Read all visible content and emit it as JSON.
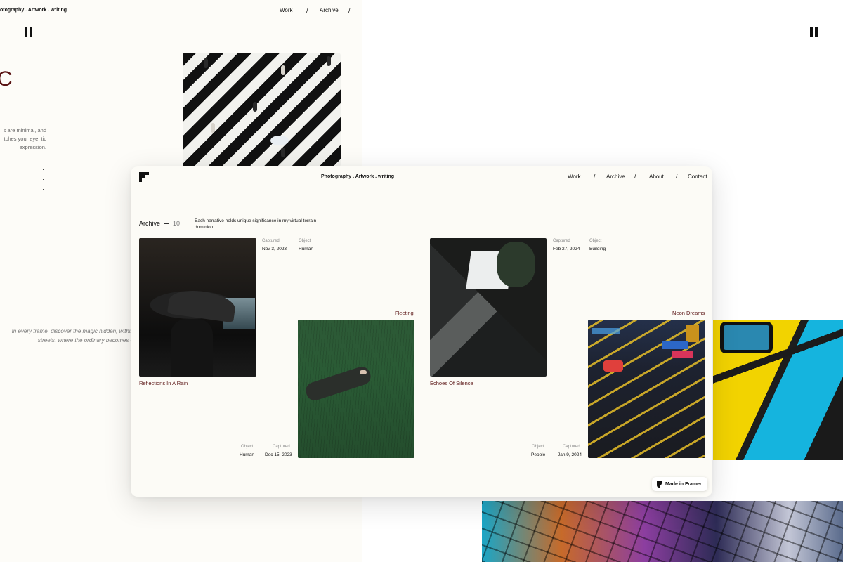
{
  "background_left": {
    "brand": "otography . Artwork . writing",
    "nav": [
      "Work",
      "/",
      "Archive",
      "/"
    ],
    "big_letter": "C",
    "description": "s are minimal, and tches your eye, tic expression.",
    "quote_line1": "In every frame, discover the magic hidden, within",
    "quote_line2": "streets, where the ordinary becomes e"
  },
  "header": {
    "brand": "Photography . Artwork . writing",
    "nav": [
      {
        "label": "Work"
      },
      {
        "label": "/"
      },
      {
        "label": "Archive"
      },
      {
        "label": "/"
      },
      {
        "label": "About"
      },
      {
        "label": "/"
      },
      {
        "label": "Contact"
      }
    ]
  },
  "archive": {
    "title": "Archive",
    "count": "10",
    "description": "Each narrative holds unique significance in my virtual terrain dominion."
  },
  "items": [
    {
      "title": "Reflections In A Rain",
      "captured_label": "Captured",
      "captured": "Nov 3, 2023",
      "object_label": "Object",
      "object": "Human"
    },
    {
      "title": "Fleeting",
      "captured_label": "Captured",
      "captured": "Dec 15, 2023",
      "object_label": "Object",
      "object": "Human"
    },
    {
      "title": "Echoes Of Silence",
      "captured_label": "Captured",
      "captured": "Feb 27, 2024",
      "object_label": "Object",
      "object": "Building"
    },
    {
      "title": "Neon Dreams",
      "captured_label": "Captured",
      "captured": "Jan 9, 2024",
      "object_label": "Object",
      "object": "People"
    }
  ],
  "badge": {
    "label": "Made in Framer"
  },
  "colors": {
    "accent": "#5a1414",
    "card_bg": "#fcfbf6"
  },
  "icons": [
    "pause-icon",
    "logo-icon",
    "framer-icon"
  ]
}
